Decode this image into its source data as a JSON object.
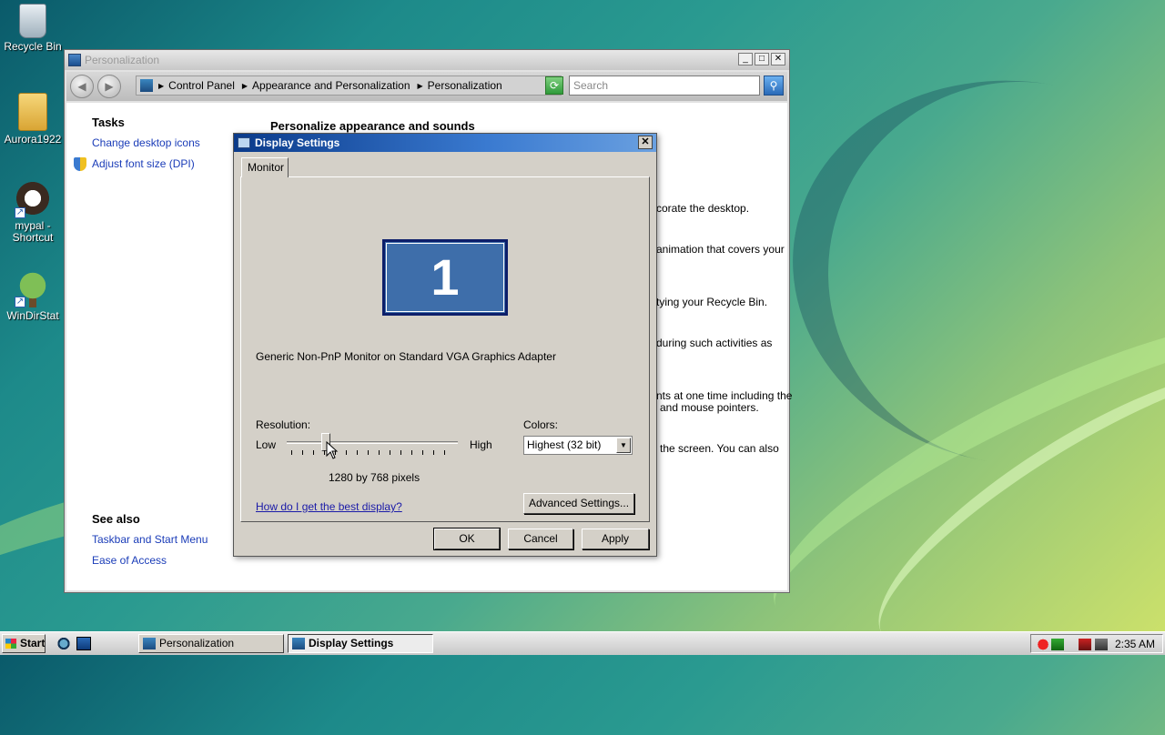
{
  "desktop": {
    "icons": [
      {
        "label": "Recycle Bin",
        "icon": "recycle-bin-icon"
      },
      {
        "label": "Aurora1922",
        "icon": "folder-icon"
      },
      {
        "label": "mypal -\nShortcut",
        "icon": "mypal-icon"
      },
      {
        "label": "WinDirStat",
        "icon": "windirstat-icon"
      }
    ]
  },
  "window": {
    "title": "Personalization",
    "controls": {
      "minimize": "_",
      "maximize": "□",
      "close": "✕"
    },
    "address": {
      "crumbs": [
        "Control Panel",
        "Appearance and Personalization",
        "Personalization"
      ]
    },
    "search_placeholder": "Search",
    "tasks": {
      "heading": "Tasks",
      "links": [
        "Change desktop icons",
        "Adjust font size (DPI)"
      ]
    },
    "see_also": {
      "heading": "See also",
      "links": [
        "Taskbar and Start Menu",
        "Ease of Access"
      ]
    },
    "main_heading": "Personalize appearance and sounds",
    "fragments": [
      "corate the desktop.",
      "animation that covers your",
      "tying your Recycle Bin.",
      "during such activities as",
      "nts at one time including the",
      "and mouse pointers.",
      "the screen. You can also"
    ]
  },
  "dialog": {
    "title": "Display Settings",
    "close": "✕",
    "tab": "Monitor",
    "monitor_number": "1",
    "monitor_name": "Generic Non-PnP Monitor on Standard VGA Graphics Adapter",
    "resolution": {
      "label": "Resolution:",
      "low": "Low",
      "high": "High",
      "value": "1280 by 768 pixels",
      "slider_position": 0.23
    },
    "colors": {
      "label": "Colors:",
      "selected": "Highest (32 bit)"
    },
    "help_link": "How do I get the best display?",
    "buttons": {
      "advanced": "Advanced Settings...",
      "ok": "OK",
      "cancel": "Cancel",
      "apply": "Apply"
    }
  },
  "taskbar": {
    "start": "Start",
    "tasks": [
      "Personalization",
      "Display Settings"
    ],
    "clock": "2:35 AM"
  }
}
